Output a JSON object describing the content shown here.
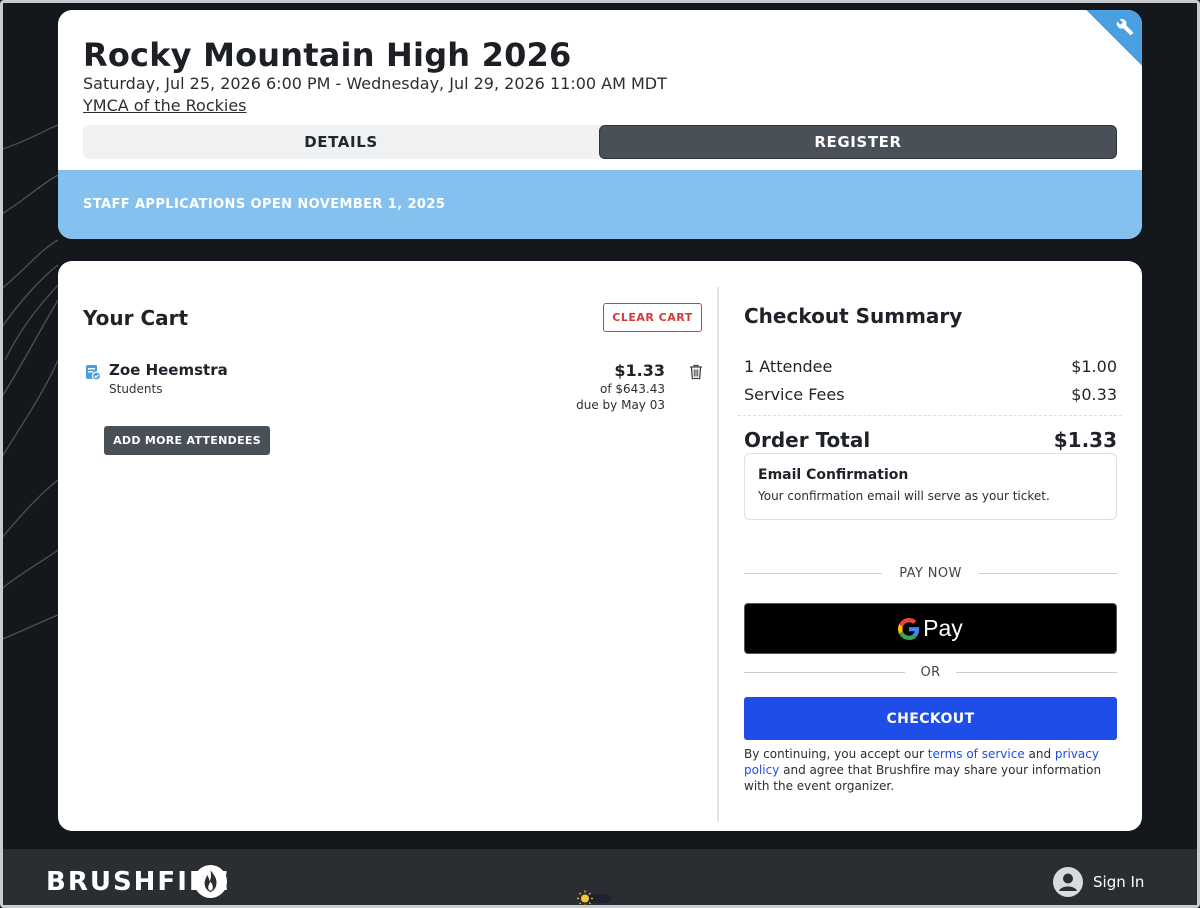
{
  "event": {
    "title": "Rocky Mountain High 2026",
    "dates": "Saturday, Jul 25, 2026 6:00 PM - Wednesday, Jul 29, 2026 11:00 AM MDT",
    "venue": "YMCA of the Rockies",
    "tabs": [
      {
        "label": "DETAILS",
        "active": false
      },
      {
        "label": "REGISTER",
        "active": true
      }
    ],
    "banner": "STAFF APPLICATIONS OPEN NOVEMBER 1, 2025"
  },
  "cart": {
    "title": "Your Cart",
    "clear_label": "CLEAR CART",
    "items": [
      {
        "name": "Zoe Heemstra",
        "type": "Students",
        "price": "$1.33",
        "of": "of $643.43",
        "due": "due by May 03"
      }
    ],
    "add_more_label": "ADD MORE ATTENDEES"
  },
  "summary": {
    "title": "Checkout Summary",
    "rows": [
      {
        "label": "1 Attendee",
        "value": "$1.00"
      },
      {
        "label": "Service Fees",
        "value": "$0.33"
      }
    ],
    "total_label": "Order Total",
    "total_value": "$1.33",
    "email_title": "Email Confirmation",
    "email_text": "Your confirmation email will serve as your ticket.",
    "pay_now_label": "PAY NOW",
    "gpay_label": "Pay",
    "or_label": "OR",
    "checkout_label": "CHECKOUT",
    "terms": {
      "prefix": "By continuing, you accept our ",
      "tos": "terms of service",
      "and": " and ",
      "privacy": "privacy policy",
      "suffix": " and agree that Brushfire may share your information with the event organizer."
    }
  },
  "footer": {
    "logo": "BRUSHFIRE",
    "signin_label": "Sign In"
  },
  "colors": {
    "accent_blue": "#1f4de8",
    "banner_blue": "#84c1ee",
    "clear_red": "#d33a3a",
    "dark_button": "#4a5058"
  }
}
